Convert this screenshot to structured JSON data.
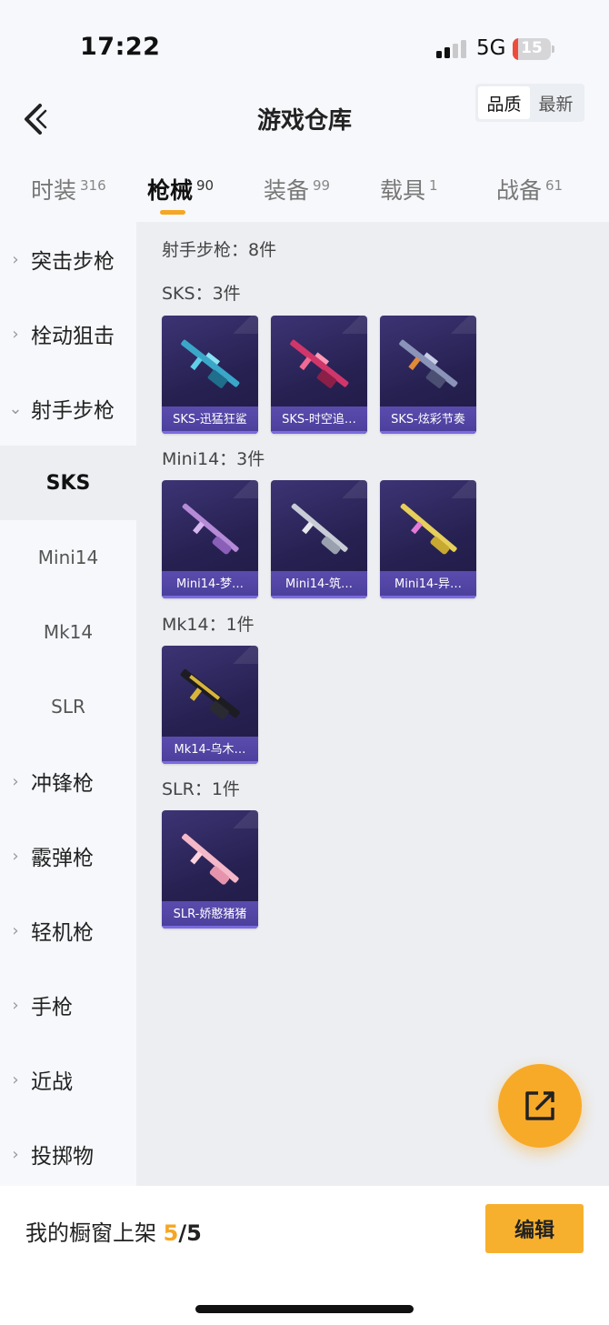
{
  "status_bar": {
    "time": "17:22",
    "network": "5G",
    "battery": "15",
    "battery_level": 0.15
  },
  "header": {
    "title": "游戏仓库",
    "sort_options": [
      "品质",
      "最新"
    ],
    "sort_active": "品质"
  },
  "tabs": [
    {
      "label": "时装",
      "count": "316"
    },
    {
      "label": "枪械",
      "count": "90",
      "active": true
    },
    {
      "label": "装备",
      "count": "99"
    },
    {
      "label": "载具",
      "count": "1"
    },
    {
      "label": "战备",
      "count": "61"
    }
  ],
  "sidebar": {
    "categories": [
      "突击步枪",
      "栓动狙击",
      "射手步枪",
      "冲锋枪",
      "霰弹枪",
      "轻机枪",
      "手枪",
      "近战",
      "投掷物"
    ],
    "subcategories": [
      "SKS",
      "Mini14",
      "Mk14",
      "SLR"
    ],
    "active_sub": "SKS"
  },
  "content": {
    "summary": "射手步枪：8件",
    "groups": [
      {
        "label": "SKS：3件",
        "items": [
          "SKS-迅猛狂鲨",
          "SKS-时空追…",
          "SKS-炫彩节奏"
        ]
      },
      {
        "label": "Mini14：3件",
        "items": [
          "Mini14-梦…",
          "Mini14-筑…",
          "Mini14-异…"
        ]
      },
      {
        "label": "Mk14：1件",
        "items": [
          "Mk14-乌木…"
        ]
      },
      {
        "label": "SLR：1件",
        "items": [
          "SLR-娇憨猪猪"
        ]
      }
    ]
  },
  "bottom_bar": {
    "showcase_label": "我的橱窗上架",
    "count": "5",
    "separator": "/",
    "total": "5",
    "edit_label": "编辑"
  },
  "icons": [
    "back-arrow-icon",
    "share-icon",
    "chevron-right-icon",
    "chevron-down-icon"
  ],
  "colors": {
    "accent": "#f5a623",
    "card_bg": "#272152",
    "card_label": "#4a3e9a"
  }
}
